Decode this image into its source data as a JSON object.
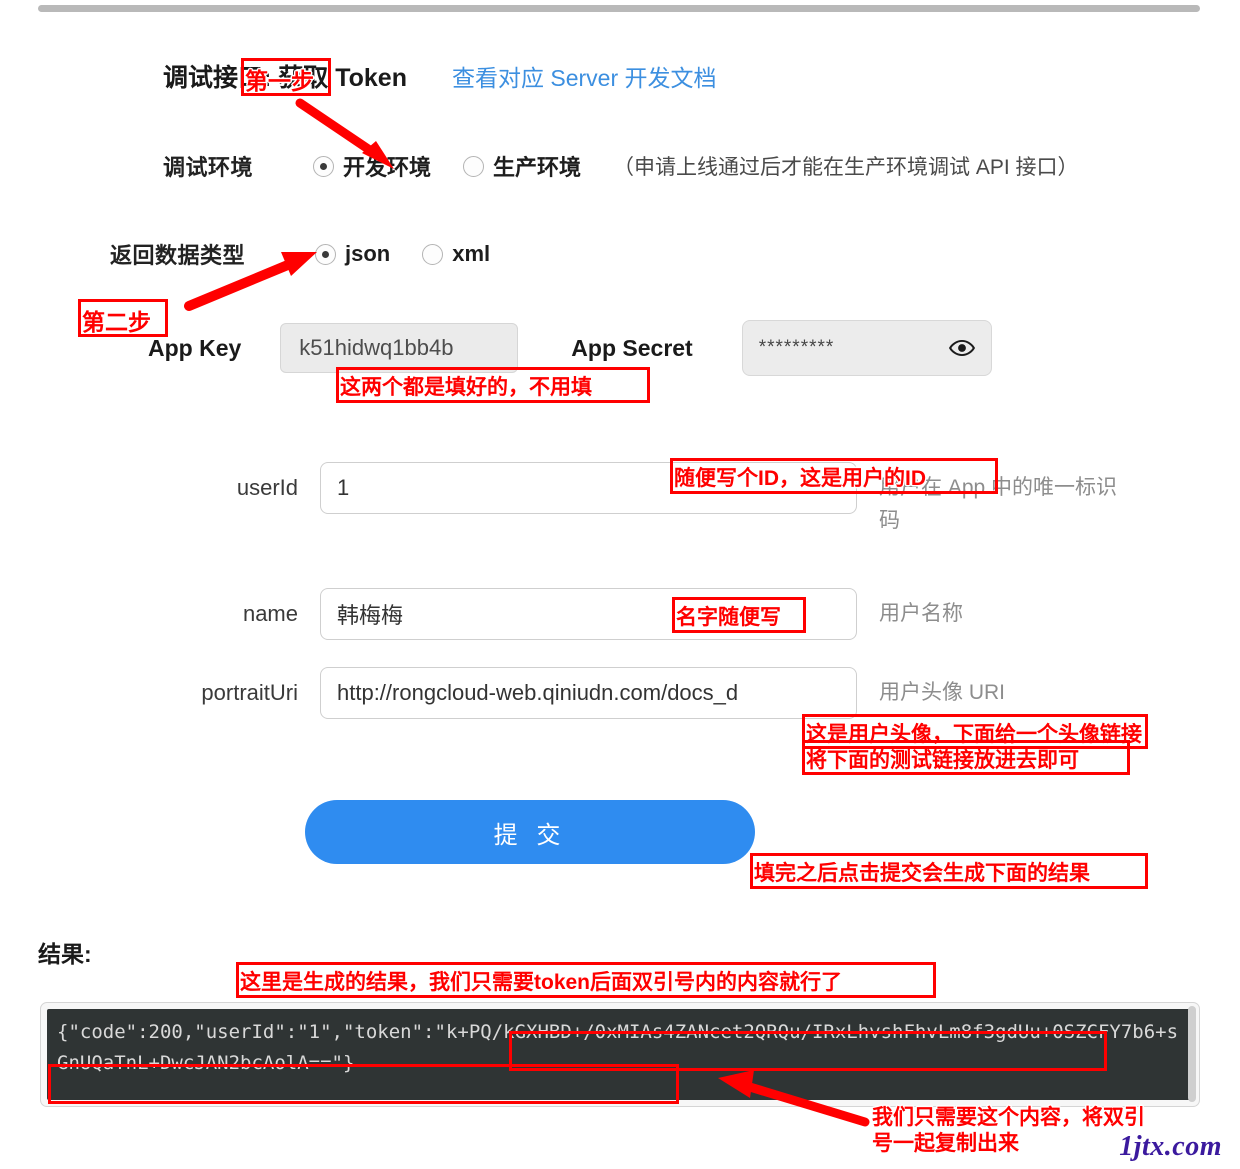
{
  "form": {
    "title": "调试接口: 获取 Token",
    "doc_link": "查看对应 Server 开发文档",
    "env": {
      "label": "调试环境",
      "options": [
        "开发环境",
        "生产环境"
      ],
      "selected": "开发环境",
      "hint": "（申请上线通过后才能在生产环境调试 API 接口）"
    },
    "datatype": {
      "label": "返回数据类型",
      "options": [
        "json",
        "xml"
      ],
      "selected": "json"
    },
    "app_key": {
      "label": "App Key",
      "value": "k51hidwq1bb4b"
    },
    "app_secret": {
      "label": "App Secret",
      "value": "*********",
      "icon": "eye-icon"
    },
    "fields": [
      {
        "name": "userId",
        "label": "userId",
        "value": "1",
        "hint": "用户在 App 中的唯一标识码"
      },
      {
        "name": "name",
        "label": "name",
        "value": "韩梅梅",
        "hint": "用户名称"
      },
      {
        "name": "portraitUri",
        "label": "portraitUri",
        "value": "http://rongcloud-web.qiniudn.com/docs_d",
        "hint": "用户头像 URI"
      }
    ],
    "submit_label": "提 交"
  },
  "result": {
    "label": "结果:",
    "body_prefix": "{\"code\":200,\"userId\":\"1\",\"token\":",
    "token": "\"k+PQ/kGXHBD+/0xMIAs4ZANcet2QRQu/IRxLhvshFhvLm8f3gdUu+0SZCFY7b6+sGnUQaTnL+DwcJAN2bcAolA==\"",
    "body_suffix": "}"
  },
  "annotations": {
    "step1": "第一步",
    "step2": "第二步",
    "keys_prefilled": "这两个都是填好的，不用填",
    "userid_note": "随便写个ID，这是用户的ID",
    "name_note": "名字随便写",
    "portrait_note_line1": "这是用户头像，下面给一个头像链接",
    "portrait_note_line2": "将下面的测试链接放进去即可",
    "submit_note": "填完之后点击提交会生成下面的结果",
    "result_note": "这里是生成的结果，我们只需要token后面双引号内的内容就行了",
    "copy_note_line1": "我们只需要这个内容，将双引",
    "copy_note_line2": "号一起复制出来"
  },
  "watermark": "1jtx.com",
  "colors": {
    "accent": "#2f8cf0",
    "link": "#3c8fe0",
    "annotation": "#ff0000",
    "console_bg": "#2f3434",
    "watermark": "#3b1a9e"
  }
}
